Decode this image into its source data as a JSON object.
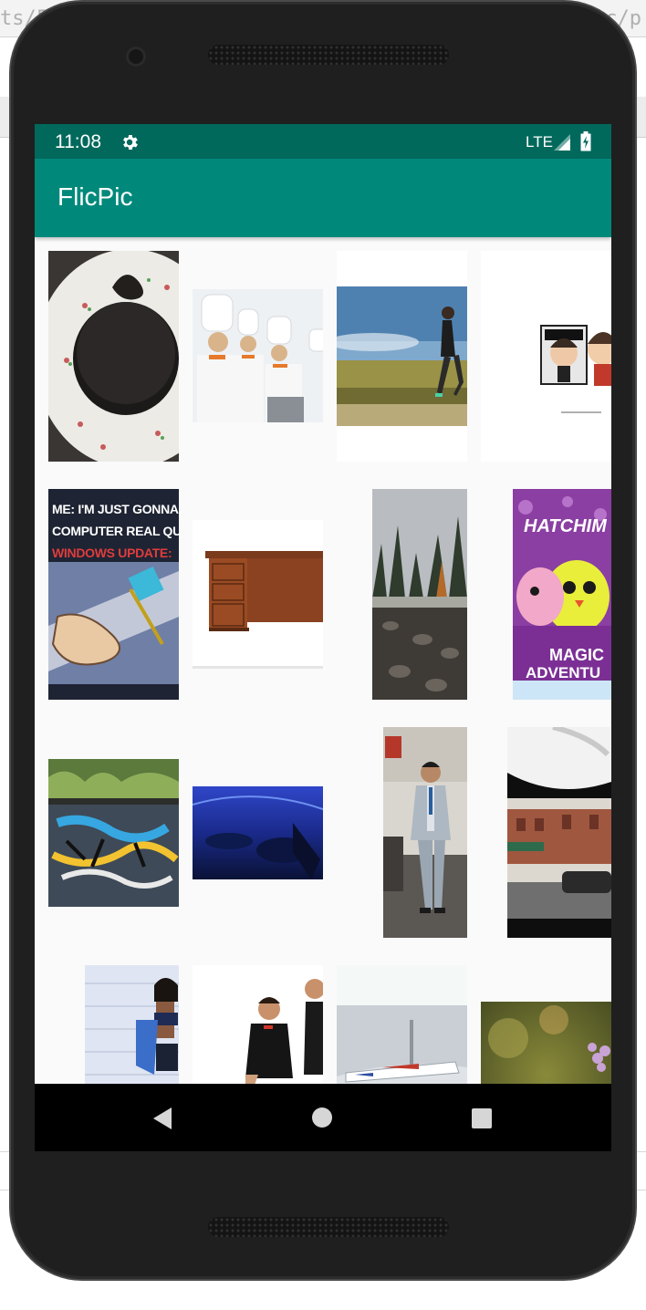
{
  "status_bar": {
    "time": "11:08",
    "network": "LTE",
    "icons": [
      "gear-icon",
      "signal-icon",
      "battery-icon"
    ]
  },
  "app_bar": {
    "title": "FlicPic"
  },
  "photo_grid": {
    "photos": [
      {
        "label": "photo-cake-on-plate"
      },
      {
        "label": "photo-chefs"
      },
      {
        "label": "photo-runner"
      },
      {
        "label": "photo-funko-figures"
      },
      {
        "label": "photo-windows-update-meme",
        "caption_lines": [
          "ME: I'M JUST GONNA",
          "COMPUTER REAL QUI",
          "WINDOWS UPDATE:"
        ]
      },
      {
        "label": "photo-wooden-desk"
      },
      {
        "label": "photo-forest-river"
      },
      {
        "label": "photo-hatchimals-book",
        "caption_lines": [
          "HATCHIM",
          "MAGIC",
          "ADVENTU"
        ]
      },
      {
        "label": "photo-graffiti"
      },
      {
        "label": "photo-underwater-blue"
      },
      {
        "label": "photo-man-in-suit"
      },
      {
        "label": "photo-street-window"
      },
      {
        "label": "photo-woman-crop-top"
      },
      {
        "label": "photo-two-people"
      },
      {
        "label": "photo-airplane"
      },
      {
        "label": "photo-flower-bokeh"
      }
    ]
  },
  "nav_bar": {
    "buttons": [
      "back",
      "home",
      "recents"
    ]
  },
  "background_editor": {
    "url_fragments": [
      "ts/F",
      "ic/p"
    ]
  },
  "colors": {
    "status_bar": "#00695c",
    "app_bar": "#00897b",
    "screen_background": "#fafafa",
    "nav_bar": "#000000"
  }
}
